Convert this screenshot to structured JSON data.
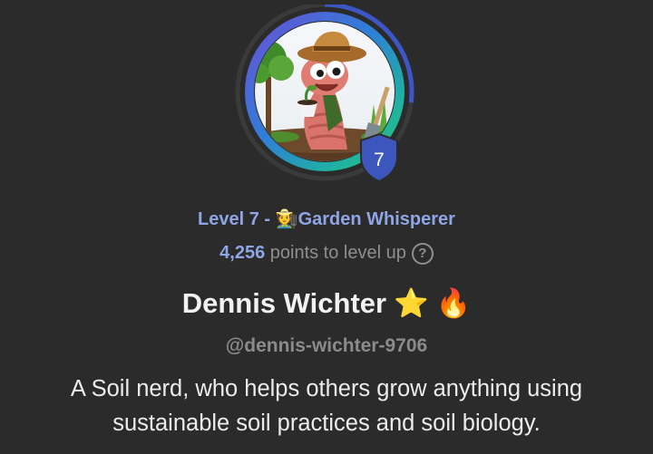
{
  "profile": {
    "avatar_alt": "worm gardener avatar",
    "level_badge": "7",
    "level_prefix": "Level 7 - ",
    "level_emoji": "🧑‍🌾",
    "level_title": "Garden Whisperer",
    "points_value": "4,256",
    "points_suffix": " points to level up",
    "help_symbol": "?",
    "name": "Dennis Wichter",
    "badge_star": "⭐",
    "badge_fire": "🔥",
    "handle": "@dennis-wichter-9706",
    "bio": "A Soil nerd, who helps others grow anything using sustainable soil practices and soil biology.",
    "level_progress": 0.27
  },
  "colors": {
    "background": "#2b2b2b",
    "accent": "#8ea5e6",
    "progress": "#3e55c6",
    "badge": "#3d56bd"
  },
  "icons": {
    "help": "question-circle-icon",
    "level_badge": "shield-icon"
  }
}
